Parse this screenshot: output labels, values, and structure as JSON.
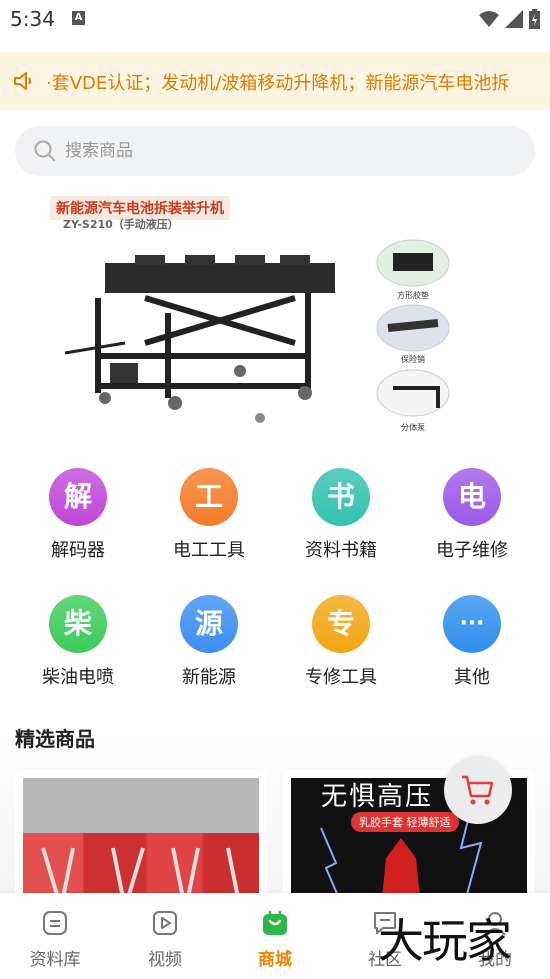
{
  "status_bar": {
    "time": "5:34",
    "notif_icon": "A"
  },
  "notice": {
    "icon": "speaker-icon",
    "text": "·套VDE认证；发动机/波箱移动升降机；新能源汽车电池拆"
  },
  "search": {
    "placeholder": "搜索商品"
  },
  "banner": {
    "title": "新能源汽车电池拆装举升机",
    "subtitle": "ZY-S210（手动液压）",
    "details": [
      "方形胶垫",
      "保险销",
      "分体泵"
    ]
  },
  "categories": [
    {
      "glyph": "解",
      "label": "解码器",
      "color": "#c048d8"
    },
    {
      "glyph": "工",
      "label": "电工工具",
      "color": "#f57c28"
    },
    {
      "glyph": "书",
      "label": "资料书籍",
      "color": "#33c1ae"
    },
    {
      "glyph": "电",
      "label": "电子维修",
      "color": "#9b59e8"
    },
    {
      "glyph": "柴",
      "label": "柴油电喷",
      "color": "#3ccc5a"
    },
    {
      "glyph": "源",
      "label": "新能源",
      "color": "#3c8ef0"
    },
    {
      "glyph": "专",
      "label": "专修工具",
      "color": "#f2a614"
    },
    {
      "glyph": "···",
      "label": "其他",
      "color": "#2f8fec"
    }
  ],
  "featured": {
    "title": "精选商品",
    "products": [
      {
        "caption": ""
      },
      {
        "caption": "无惧高压",
        "tag": "乳胶手套 轻薄舒适"
      }
    ]
  },
  "bottom_nav": [
    {
      "label": "资料库",
      "icon": "document-icon",
      "active": false
    },
    {
      "label": "视频",
      "icon": "video-icon",
      "active": false
    },
    {
      "label": "商城",
      "icon": "shopping-bag-icon",
      "active": true
    },
    {
      "label": "社区",
      "icon": "chat-icon",
      "active": false
    },
    {
      "label": "我的",
      "icon": "user-icon",
      "active": false
    }
  ],
  "watermark": "大玩家",
  "colors": {
    "accent": "#f08300",
    "active_nav": "#2ab84c"
  }
}
